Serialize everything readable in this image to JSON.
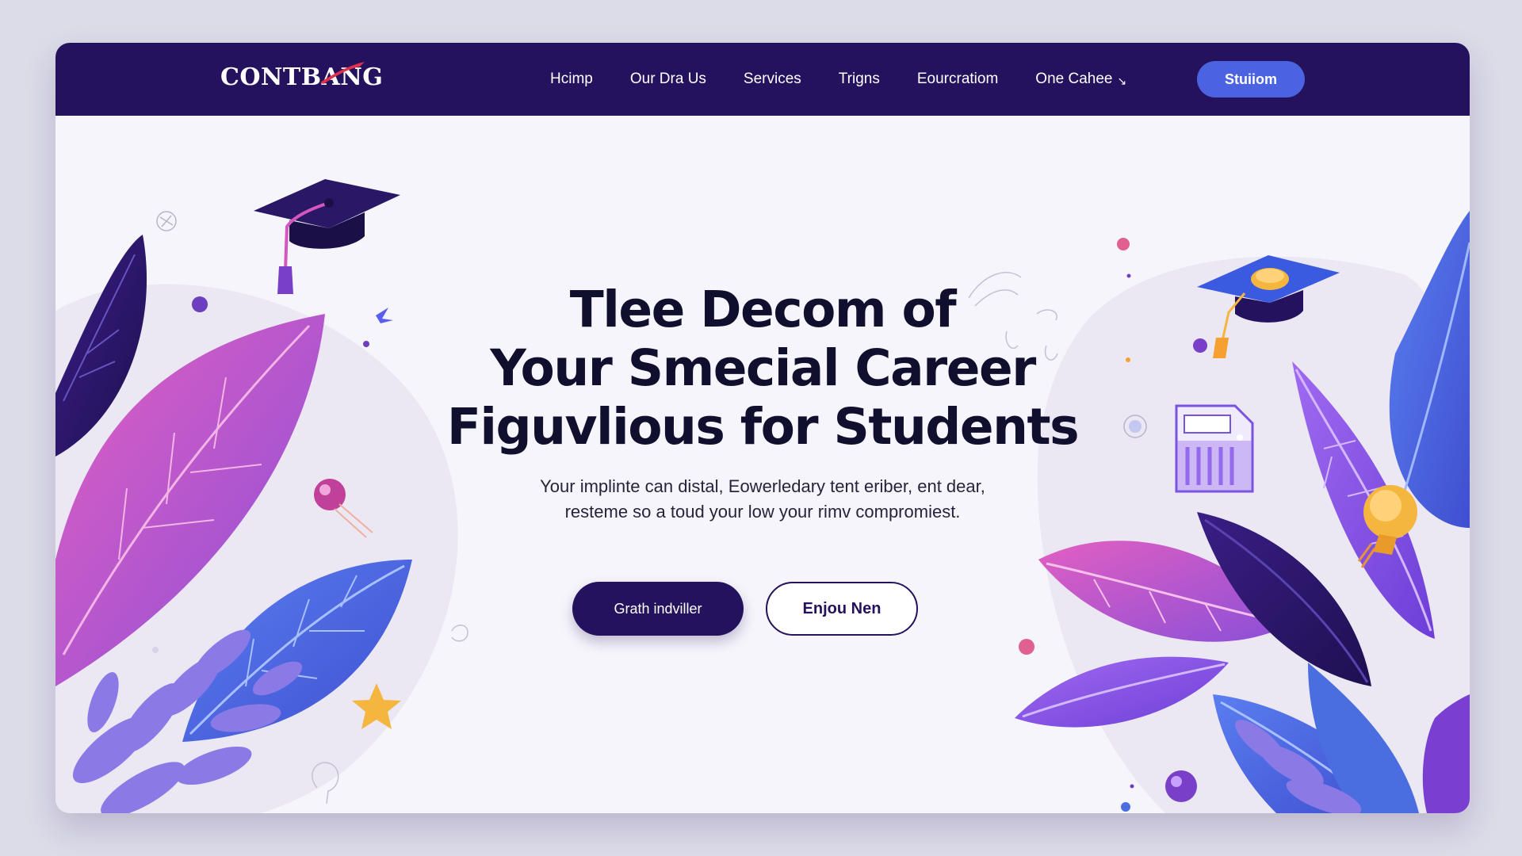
{
  "nav": {
    "logo": "CONTBANG",
    "items": [
      {
        "label": "Hcimp"
      },
      {
        "label": "Our Dra Us"
      },
      {
        "label": "Services"
      },
      {
        "label": "Trigns"
      },
      {
        "label": "Eourcratiom"
      },
      {
        "label": "One Cahee",
        "has_dropdown": true
      }
    ],
    "cta": "Stuiiom"
  },
  "hero": {
    "headline_lines": [
      "Tlee Decom of",
      "Your Smecial Career",
      "Figuvlious for Students"
    ],
    "subtitle_lines": [
      "Your implinte can distal, Eowerledary tent eriber, ent dear,",
      "resteme so a toud your low your rimv compromiest."
    ],
    "primary_button": "Grath indviller",
    "secondary_button": "Enjou Nen"
  },
  "icons": {
    "graduation_cap_left": "graduation-cap-icon",
    "graduation_cap_right": "graduation-cap-icon",
    "document": "document-icon",
    "lightbulb": "lightbulb-icon",
    "star": "star-icon",
    "chevron": "chevron-down-icon"
  },
  "colors": {
    "nav_bg": "#24125e",
    "accent": "#4b63e0",
    "pink": "#d457c0",
    "purple": "#8a4fe0",
    "blue": "#4a6ee0",
    "dark": "#110f2e"
  }
}
